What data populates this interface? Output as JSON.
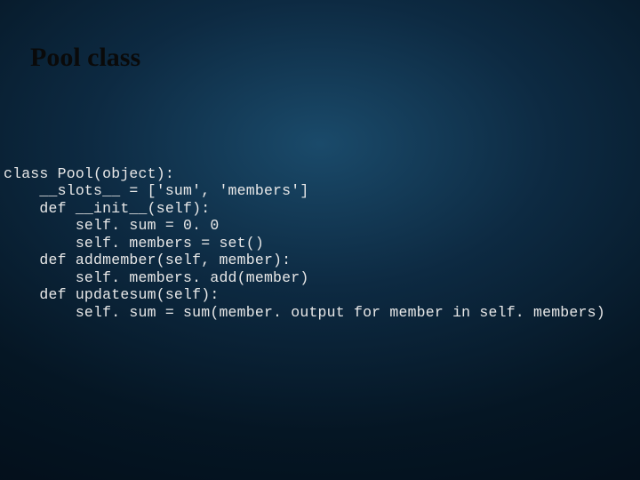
{
  "title": "Pool class",
  "code": {
    "line1": "class Pool(object):",
    "line2": "    __slots__ = ['sum', 'members']",
    "line3": "    def __init__(self):",
    "line4": "        self. sum = 0. 0",
    "line5": "        self. members = set()",
    "line6": "    def addmember(self, member):",
    "line7": "        self. members. add(member)",
    "line8": "    def updatesum(self):",
    "line9": "        self. sum = sum(member. output for member in self. members)"
  }
}
